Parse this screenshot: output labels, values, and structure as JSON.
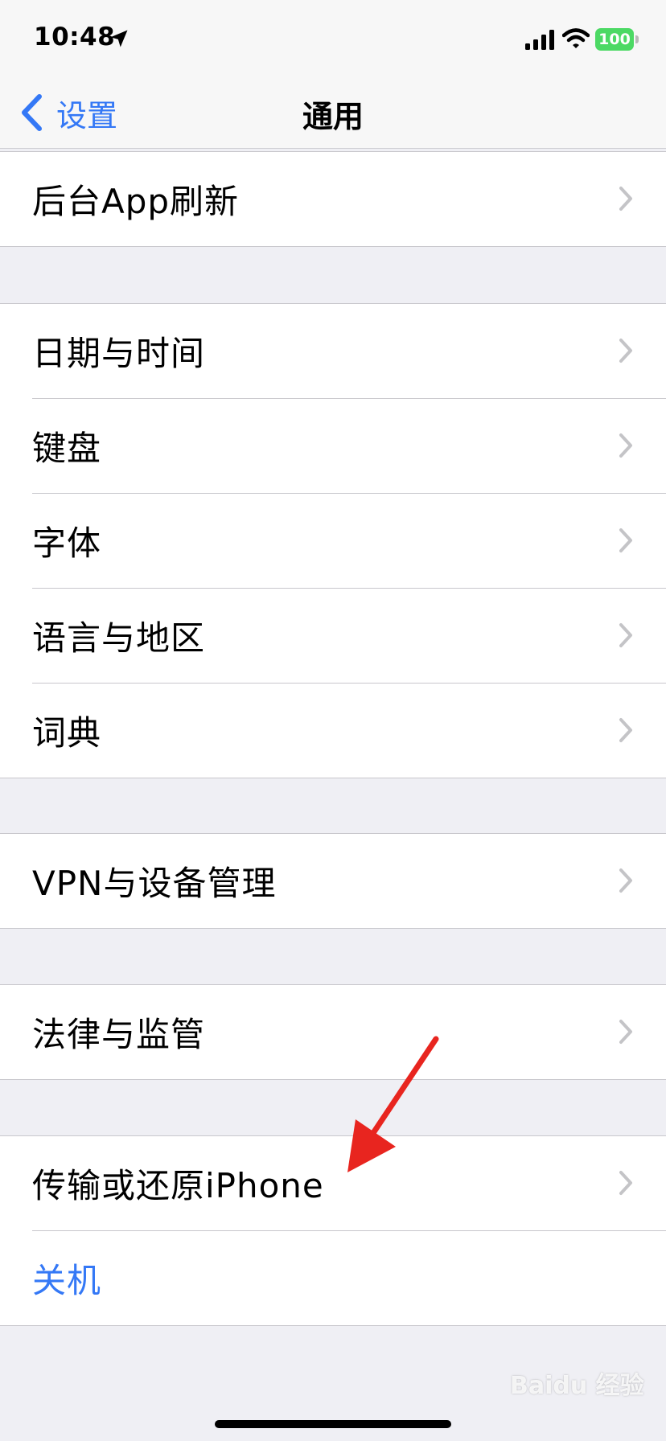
{
  "status_bar": {
    "time": "10:48",
    "battery": "100"
  },
  "nav": {
    "back_label": "设置",
    "title": "通用"
  },
  "groups": [
    {
      "items": [
        "后台App刷新"
      ]
    },
    {
      "items": [
        "日期与时间",
        "键盘",
        "字体",
        "语言与地区",
        "词典"
      ]
    },
    {
      "items": [
        "VPN与设备管理"
      ]
    },
    {
      "items": [
        "法律与监管"
      ]
    },
    {
      "items": [
        "传输或还原iPhone",
        "关机"
      ]
    }
  ],
  "watermark": "Baidu 经验",
  "colors": {
    "accent": "#3478f6",
    "battery": "#4cd964",
    "annotation": "#e8251f"
  }
}
